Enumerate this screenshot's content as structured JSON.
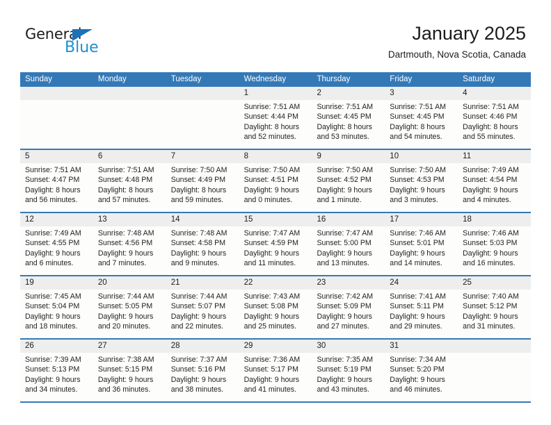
{
  "brand": {
    "name_part1": "General",
    "name_part2": "Blue",
    "accent_color": "#1d8fd1",
    "triangle_color": "#1d71b8"
  },
  "header": {
    "title": "January 2025",
    "location": "Dartmouth, Nova Scotia, Canada"
  },
  "calendar": {
    "header_color": "#3479b7",
    "weekday_headers": [
      "Sunday",
      "Monday",
      "Tuesday",
      "Wednesday",
      "Thursday",
      "Friday",
      "Saturday"
    ],
    "weeks": [
      [
        {
          "day": "",
          "sunrise": "",
          "sunset": "",
          "daylight": ""
        },
        {
          "day": "",
          "sunrise": "",
          "sunset": "",
          "daylight": ""
        },
        {
          "day": "",
          "sunrise": "",
          "sunset": "",
          "daylight": ""
        },
        {
          "day": "1",
          "sunrise": "Sunrise: 7:51 AM",
          "sunset": "Sunset: 4:44 PM",
          "daylight": "Daylight: 8 hours and 52 minutes."
        },
        {
          "day": "2",
          "sunrise": "Sunrise: 7:51 AM",
          "sunset": "Sunset: 4:45 PM",
          "daylight": "Daylight: 8 hours and 53 minutes."
        },
        {
          "day": "3",
          "sunrise": "Sunrise: 7:51 AM",
          "sunset": "Sunset: 4:45 PM",
          "daylight": "Daylight: 8 hours and 54 minutes."
        },
        {
          "day": "4",
          "sunrise": "Sunrise: 7:51 AM",
          "sunset": "Sunset: 4:46 PM",
          "daylight": "Daylight: 8 hours and 55 minutes."
        }
      ],
      [
        {
          "day": "5",
          "sunrise": "Sunrise: 7:51 AM",
          "sunset": "Sunset: 4:47 PM",
          "daylight": "Daylight: 8 hours and 56 minutes."
        },
        {
          "day": "6",
          "sunrise": "Sunrise: 7:51 AM",
          "sunset": "Sunset: 4:48 PM",
          "daylight": "Daylight: 8 hours and 57 minutes."
        },
        {
          "day": "7",
          "sunrise": "Sunrise: 7:50 AM",
          "sunset": "Sunset: 4:49 PM",
          "daylight": "Daylight: 8 hours and 59 minutes."
        },
        {
          "day": "8",
          "sunrise": "Sunrise: 7:50 AM",
          "sunset": "Sunset: 4:51 PM",
          "daylight": "Daylight: 9 hours and 0 minutes."
        },
        {
          "day": "9",
          "sunrise": "Sunrise: 7:50 AM",
          "sunset": "Sunset: 4:52 PM",
          "daylight": "Daylight: 9 hours and 1 minute."
        },
        {
          "day": "10",
          "sunrise": "Sunrise: 7:50 AM",
          "sunset": "Sunset: 4:53 PM",
          "daylight": "Daylight: 9 hours and 3 minutes."
        },
        {
          "day": "11",
          "sunrise": "Sunrise: 7:49 AM",
          "sunset": "Sunset: 4:54 PM",
          "daylight": "Daylight: 9 hours and 4 minutes."
        }
      ],
      [
        {
          "day": "12",
          "sunrise": "Sunrise: 7:49 AM",
          "sunset": "Sunset: 4:55 PM",
          "daylight": "Daylight: 9 hours and 6 minutes."
        },
        {
          "day": "13",
          "sunrise": "Sunrise: 7:48 AM",
          "sunset": "Sunset: 4:56 PM",
          "daylight": "Daylight: 9 hours and 7 minutes."
        },
        {
          "day": "14",
          "sunrise": "Sunrise: 7:48 AM",
          "sunset": "Sunset: 4:58 PM",
          "daylight": "Daylight: 9 hours and 9 minutes."
        },
        {
          "day": "15",
          "sunrise": "Sunrise: 7:47 AM",
          "sunset": "Sunset: 4:59 PM",
          "daylight": "Daylight: 9 hours and 11 minutes."
        },
        {
          "day": "16",
          "sunrise": "Sunrise: 7:47 AM",
          "sunset": "Sunset: 5:00 PM",
          "daylight": "Daylight: 9 hours and 13 minutes."
        },
        {
          "day": "17",
          "sunrise": "Sunrise: 7:46 AM",
          "sunset": "Sunset: 5:01 PM",
          "daylight": "Daylight: 9 hours and 14 minutes."
        },
        {
          "day": "18",
          "sunrise": "Sunrise: 7:46 AM",
          "sunset": "Sunset: 5:03 PM",
          "daylight": "Daylight: 9 hours and 16 minutes."
        }
      ],
      [
        {
          "day": "19",
          "sunrise": "Sunrise: 7:45 AM",
          "sunset": "Sunset: 5:04 PM",
          "daylight": "Daylight: 9 hours and 18 minutes."
        },
        {
          "day": "20",
          "sunrise": "Sunrise: 7:44 AM",
          "sunset": "Sunset: 5:05 PM",
          "daylight": "Daylight: 9 hours and 20 minutes."
        },
        {
          "day": "21",
          "sunrise": "Sunrise: 7:44 AM",
          "sunset": "Sunset: 5:07 PM",
          "daylight": "Daylight: 9 hours and 22 minutes."
        },
        {
          "day": "22",
          "sunrise": "Sunrise: 7:43 AM",
          "sunset": "Sunset: 5:08 PM",
          "daylight": "Daylight: 9 hours and 25 minutes."
        },
        {
          "day": "23",
          "sunrise": "Sunrise: 7:42 AM",
          "sunset": "Sunset: 5:09 PM",
          "daylight": "Daylight: 9 hours and 27 minutes."
        },
        {
          "day": "24",
          "sunrise": "Sunrise: 7:41 AM",
          "sunset": "Sunset: 5:11 PM",
          "daylight": "Daylight: 9 hours and 29 minutes."
        },
        {
          "day": "25",
          "sunrise": "Sunrise: 7:40 AM",
          "sunset": "Sunset: 5:12 PM",
          "daylight": "Daylight: 9 hours and 31 minutes."
        }
      ],
      [
        {
          "day": "26",
          "sunrise": "Sunrise: 7:39 AM",
          "sunset": "Sunset: 5:13 PM",
          "daylight": "Daylight: 9 hours and 34 minutes."
        },
        {
          "day": "27",
          "sunrise": "Sunrise: 7:38 AM",
          "sunset": "Sunset: 5:15 PM",
          "daylight": "Daylight: 9 hours and 36 minutes."
        },
        {
          "day": "28",
          "sunrise": "Sunrise: 7:37 AM",
          "sunset": "Sunset: 5:16 PM",
          "daylight": "Daylight: 9 hours and 38 minutes."
        },
        {
          "day": "29",
          "sunrise": "Sunrise: 7:36 AM",
          "sunset": "Sunset: 5:17 PM",
          "daylight": "Daylight: 9 hours and 41 minutes."
        },
        {
          "day": "30",
          "sunrise": "Sunrise: 7:35 AM",
          "sunset": "Sunset: 5:19 PM",
          "daylight": "Daylight: 9 hours and 43 minutes."
        },
        {
          "day": "31",
          "sunrise": "Sunrise: 7:34 AM",
          "sunset": "Sunset: 5:20 PM",
          "daylight": "Daylight: 9 hours and 46 minutes."
        },
        {
          "day": "",
          "sunrise": "",
          "sunset": "",
          "daylight": ""
        }
      ]
    ]
  }
}
